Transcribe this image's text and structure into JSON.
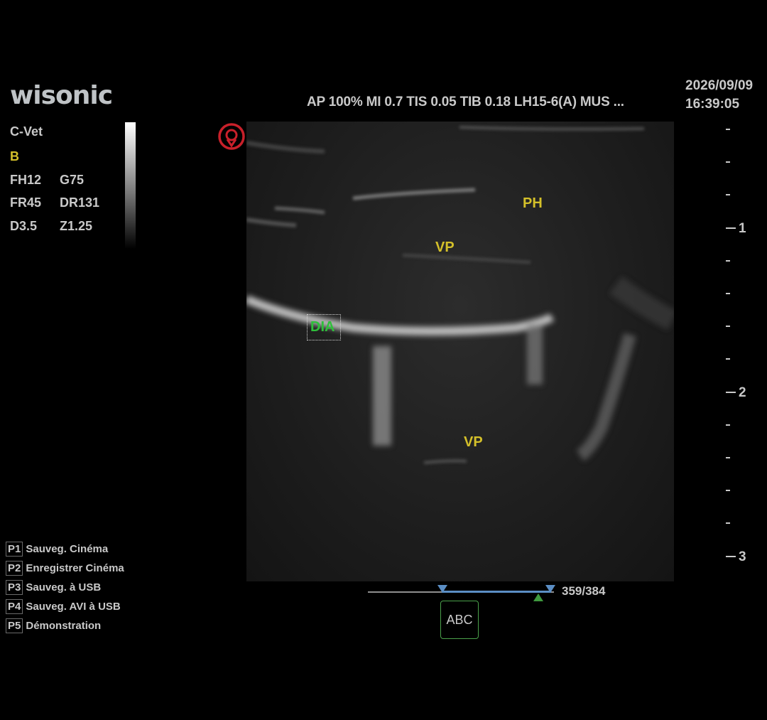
{
  "brand": "wisonic",
  "header": {
    "params": "AP 100% MI 0.7 TIS 0.05  TIB 0.18 LH15-6(A)  MUS ...",
    "date": "2026/09/09",
    "time": "16:39:05"
  },
  "left_info": {
    "preset": "C-Vet",
    "mode": "B",
    "fh": "FH12",
    "g": "G75",
    "fr": "FR45",
    "dr": "DR131",
    "d": "D3.5",
    "z": "Z1.25"
  },
  "annotations": {
    "ph": "PH",
    "vp_top": "VP",
    "dia": "DIA",
    "vp_bottom": "VP"
  },
  "depth_scale": {
    "labels": [
      "1",
      "2",
      "3"
    ]
  },
  "cine": {
    "frame_counter": "359/384",
    "progress": 0.935
  },
  "abc_button": "ABC",
  "presets": [
    {
      "key": "P1",
      "label": "Sauveg. Cinéma"
    },
    {
      "key": "P2",
      "label": "Enregistrer Cinéma"
    },
    {
      "key": "P3",
      "label": "Sauveg. à USB"
    },
    {
      "key": "P4",
      "label": "Sauveg. AVI à USB"
    },
    {
      "key": "P5",
      "label": "Démonstration"
    }
  ],
  "colors": {
    "annotation_yellow": "#d4c02a",
    "annotation_green": "#2fbf3b",
    "cine_blue": "#5b8ec4",
    "orient_red": "#c8202a"
  },
  "icons": {
    "orientation": "orientation-marker-icon",
    "cine_marker": "triangle-marker-icon"
  }
}
